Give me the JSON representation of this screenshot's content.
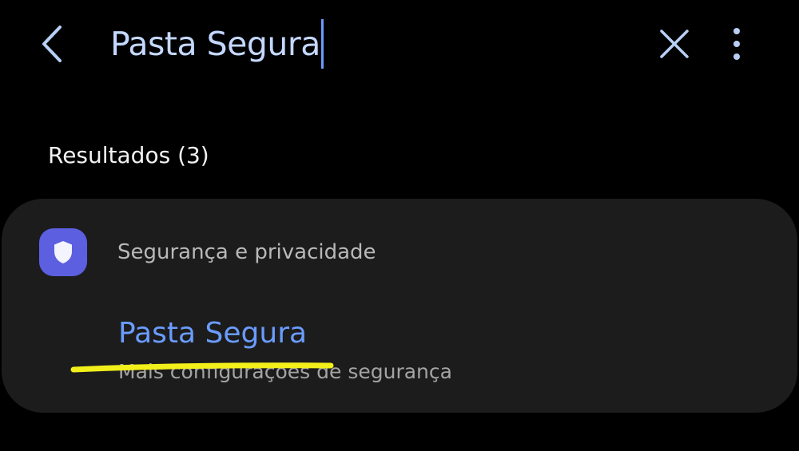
{
  "search": {
    "query": "Pasta Segura"
  },
  "icons": {
    "back": "chevron-left-icon",
    "clear": "close-icon",
    "more": "more-vertical-icon",
    "app": "shield-icon"
  },
  "results": {
    "header": "Resultados (3)",
    "groups": [
      {
        "category": "Segurança e privacidade",
        "items": [
          {
            "title": "Pasta Segura",
            "subtitle": "Mais configurações de segurança"
          }
        ]
      }
    ]
  },
  "colors": {
    "background": "#000000",
    "card": "#1c1c1c",
    "accent": "#6a9cff",
    "icon_accent": "#5b5fe0",
    "highlight": "#f2ef1a"
  }
}
